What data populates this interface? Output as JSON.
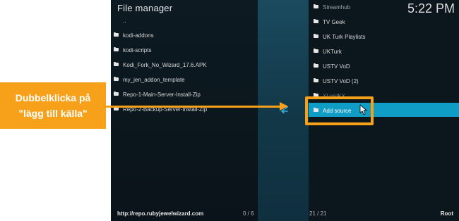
{
  "window": {
    "title": "File manager",
    "clock": "5:22 PM"
  },
  "left_list": {
    "items": [
      {
        "label": "..",
        "icon": "none"
      },
      {
        "label": "kodi-addons",
        "icon": "folder-icon"
      },
      {
        "label": "kodi-scripts",
        "icon": "folder-icon"
      },
      {
        "label": "Kodi_Fork_No_Wizard_17.6.APK",
        "icon": "folder-icon"
      },
      {
        "label": "my_jen_addon_template",
        "icon": "folder-icon"
      },
      {
        "label": "Repo-1-Main-Server-Install-Zip",
        "icon": "folder-icon"
      },
      {
        "label": "Repo-2-Backup-Server-Install-Zip",
        "icon": "folder-icon"
      }
    ]
  },
  "right_list": {
    "items": [
      {
        "label": "Streamhub",
        "icon": "folder-icon"
      },
      {
        "label": "TV Geek",
        "icon": "folder-icon"
      },
      {
        "label": "UK Turk Playlists",
        "icon": "folder-icon"
      },
      {
        "label": "UKTurk",
        "icon": "folder-icon"
      },
      {
        "label": "USTV VoD",
        "icon": "folder-icon"
      },
      {
        "label": "USTV VoD (2)",
        "icon": "folder-icon"
      },
      {
        "label": "XLordKX",
        "icon": "folder-icon"
      },
      {
        "label": "Add source",
        "icon": "folder-icon"
      }
    ],
    "selected": "Add source"
  },
  "footer": {
    "path": "http://repo.rubyjewelwizard.com",
    "left_count": "0 / 6",
    "right_count": "21 / 21",
    "right_path": "Root"
  },
  "callout": {
    "line1": "Dubbelklicka på",
    "line2": "\"lägg till källa\""
  },
  "colors": {
    "accent": "#f7a11a",
    "highlight": "#0f9cc5",
    "background": "#0d1a22"
  }
}
